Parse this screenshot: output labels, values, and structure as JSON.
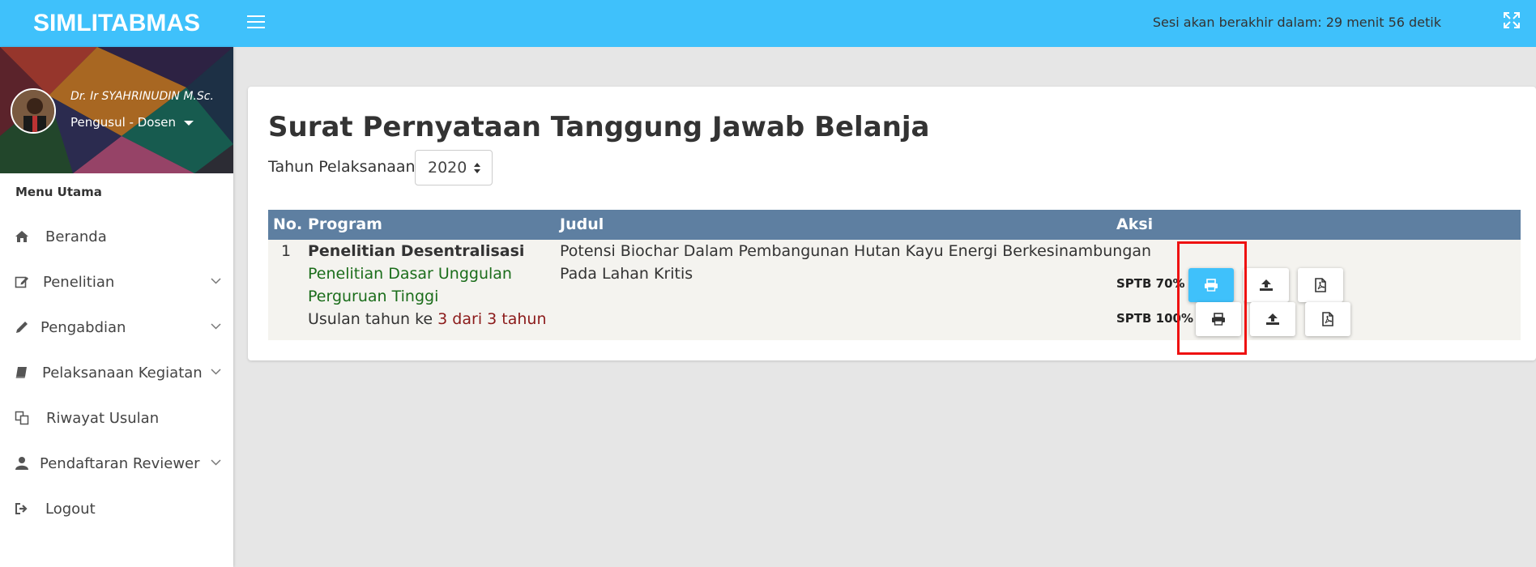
{
  "app": {
    "brand": "SIMLITABMAS"
  },
  "header": {
    "session_text": "Sesi akan berakhir dalam: 29 menit 56 detik"
  },
  "user": {
    "name": "Dr. Ir SYAHRINUDIN M.Sc.",
    "role": "Pengusul - Dosen"
  },
  "sidebar": {
    "menu_header": "Menu Utama",
    "items": [
      {
        "label": "Beranda",
        "icon": "home-icon",
        "has_submenu": false
      },
      {
        "label": "Penelitian",
        "icon": "edit-icon",
        "has_submenu": true
      },
      {
        "label": "Pengabdian",
        "icon": "pencil-icon",
        "has_submenu": true
      },
      {
        "label": "Pelaksanaan Kegiatan",
        "icon": "book-icon",
        "has_submenu": true
      },
      {
        "label": "Riwayat Usulan",
        "icon": "copy-icon",
        "has_submenu": false
      },
      {
        "label": "Pendaftaran Reviewer",
        "icon": "user-icon",
        "has_submenu": true
      },
      {
        "label": "Logout",
        "icon": "sign-out-icon",
        "has_submenu": false
      }
    ]
  },
  "main": {
    "title": "Surat Pernyataan Tanggung Jawab Belanja",
    "year_label": "Tahun Pelaksanaan:",
    "year_value": "2020",
    "table": {
      "headers": [
        "No.",
        "Program",
        "Judul",
        "Aksi"
      ],
      "row": {
        "no": "1",
        "program_title": "Penelitian Desentralisasi",
        "program_sub_1": "Penelitian Dasar Unggulan",
        "program_sub_2": "Perguruan Tinggi",
        "program_year_prefix": "Usulan tahun ke ",
        "program_year_value": "3 dari 3 tahun",
        "judul_1": "Potensi Biochar Dalam Pembangunan Hutan Kayu Energi Berkesinambungan",
        "judul_2": "Pada Lahan Kritis",
        "actions": [
          {
            "label": "SPTB 70%",
            "buttons": [
              "print-icon",
              "upload-icon",
              "file-pdf-icon"
            ]
          },
          {
            "label": "SPTB 100%",
            "buttons": [
              "print-icon",
              "upload-icon",
              "file-pdf-icon"
            ]
          }
        ]
      }
    }
  },
  "colors": {
    "topbar": "#3fc1fb",
    "table_header": "#5e7fa1",
    "highlight": "#ee1111"
  }
}
